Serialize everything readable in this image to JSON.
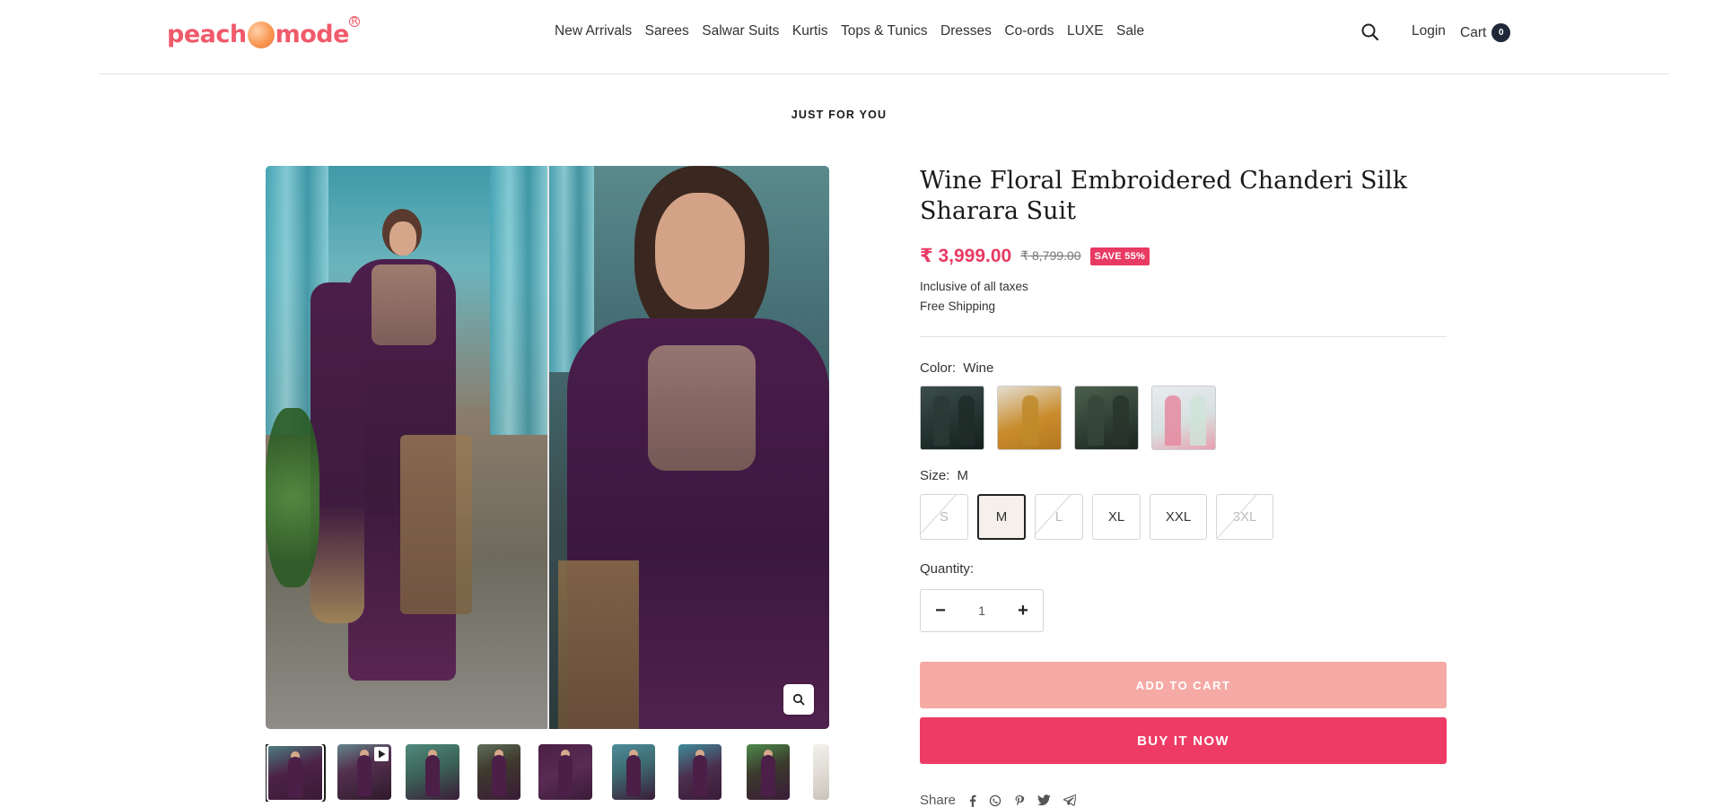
{
  "brand": {
    "logo_left": "peach",
    "logo_right": "mode",
    "reg_mark": "R"
  },
  "nav": {
    "items": [
      "New Arrivals",
      "Sarees",
      "Salwar Suits",
      "Kurtis",
      "Tops & Tunics",
      "Dresses",
      "Co-ords",
      "LUXE",
      "Sale"
    ]
  },
  "header": {
    "login_label": "Login",
    "cart_label": "Cart",
    "cart_count": "0"
  },
  "section": {
    "title": "JUST FOR YOU"
  },
  "product": {
    "title": "Wine Floral Embroidered Chanderi Silk Sharara Suit",
    "price": "₹ 3,999.00",
    "compare_price": "₹ 8,799.00",
    "save_badge": "SAVE 55%",
    "tax_note": "Inclusive of all taxes",
    "shipping_note": "Free Shipping",
    "color": {
      "label": "Color:",
      "value": "Wine"
    },
    "size": {
      "label": "Size:",
      "value": "M",
      "options": [
        {
          "label": "S",
          "state": "disabled"
        },
        {
          "label": "M",
          "state": "active"
        },
        {
          "label": "L",
          "state": "disabled"
        },
        {
          "label": "XL",
          "state": "available"
        },
        {
          "label": "XXL",
          "state": "available"
        },
        {
          "label": "3XL",
          "state": "disabled"
        }
      ]
    },
    "quantity": {
      "label": "Quantity:",
      "value": "1",
      "minus": "−",
      "plus": "+"
    },
    "add_to_cart": "ADD TO CART",
    "buy_now": "BUY IT NOW",
    "share_label": "Share",
    "share_icons": [
      "facebook-icon",
      "whatsapp-icon",
      "pinterest-icon",
      "twitter-icon",
      "telegram-icon"
    ]
  },
  "colors": {
    "accent": "#ee3b66",
    "accent_light": "#f5aaa5",
    "price": "#e83a63",
    "cart_badge": "#1e2838"
  }
}
